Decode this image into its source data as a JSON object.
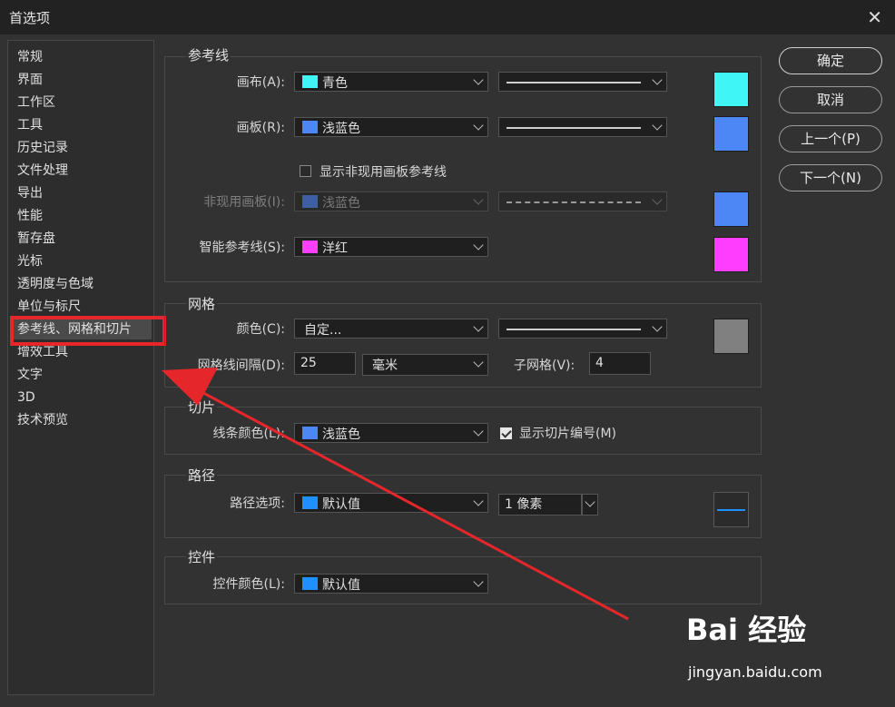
{
  "window": {
    "title": "首选项"
  },
  "sidebar": {
    "items": [
      {
        "label": "常规"
      },
      {
        "label": "界面"
      },
      {
        "label": "工作区"
      },
      {
        "label": "工具"
      },
      {
        "label": "历史记录"
      },
      {
        "label": "文件处理"
      },
      {
        "label": "导出"
      },
      {
        "label": "性能"
      },
      {
        "label": "暂存盘"
      },
      {
        "label": "光标"
      },
      {
        "label": "透明度与色域"
      },
      {
        "label": "单位与标尺"
      },
      {
        "label": "参考线、网格和切片",
        "selected": true
      },
      {
        "label": "增效工具"
      },
      {
        "label": "文字"
      },
      {
        "label": "3D"
      },
      {
        "label": "技术预览"
      }
    ]
  },
  "guides": {
    "title": "参考线",
    "canvas": {
      "label": "画布(A):",
      "color_name": "青色",
      "color": "#3ff5f5"
    },
    "artboard": {
      "label": "画板(R):",
      "color_name": "浅蓝色",
      "color": "#4d86f5"
    },
    "show_inactive": {
      "label": "显示非现用画板参考线",
      "checked": false
    },
    "inactive_artboard": {
      "label": "非现用画板(I):",
      "color_name": "浅蓝色",
      "color": "#4d86f5",
      "style": "dashed"
    },
    "smart_guides": {
      "label": "智能参考线(S):",
      "color_name": "洋红",
      "color": "#ff3dff"
    }
  },
  "grid": {
    "title": "网格",
    "color": {
      "label": "颜色(C):",
      "value": "自定...",
      "color": "#808080"
    },
    "gridline": {
      "label": "网格线间隔(D):",
      "value": "25",
      "unit": "毫米"
    },
    "subdivisions": {
      "label": "子网格(V):",
      "value": "4"
    }
  },
  "slices": {
    "title": "切片",
    "line_color": {
      "label": "线条颜色(L):",
      "color_name": "浅蓝色",
      "color": "#4d86f5"
    },
    "show_numbers": {
      "label": "显示切片编号(M)",
      "checked": true
    }
  },
  "path": {
    "title": "路径",
    "options": {
      "label": "路径选项:",
      "color_name": "默认值",
      "color": "#1e90ff"
    },
    "width": "1 像素"
  },
  "controls": {
    "title": "控件",
    "color": {
      "label": "控件颜色(L):",
      "color_name": "默认值",
      "color": "#1e90ff"
    }
  },
  "buttons": {
    "ok": "确定",
    "cancel": "取消",
    "prev": "上一个(P)",
    "next": "下一个(N)"
  },
  "watermark": {
    "logo": "Bai 经验",
    "url": "jingyan.baidu.com"
  }
}
